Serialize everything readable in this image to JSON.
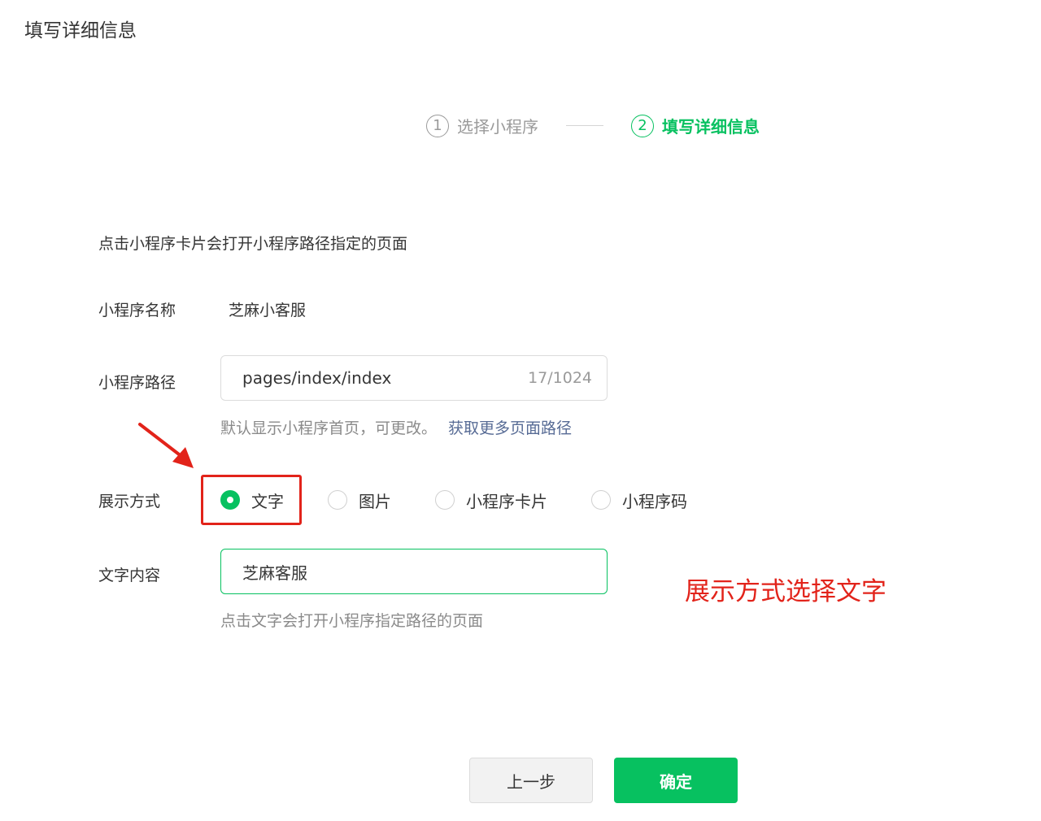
{
  "page": {
    "title": "填写详细信息"
  },
  "steps": [
    {
      "num": "1",
      "label": "选择小程序"
    },
    {
      "num": "2",
      "label": "填写详细信息"
    }
  ],
  "form": {
    "intro": "点击小程序卡片会打开小程序路径指定的页面",
    "name_label": "小程序名称",
    "name_value": "芝麻小客服",
    "path_label": "小程序路径",
    "path_value": "pages/index/index",
    "path_count": "17/1024",
    "path_hint": "默认显示小程序首页，可更改。",
    "path_link": "获取更多页面路径",
    "display_label": "展示方式",
    "display_options": [
      "文字",
      "图片",
      "小程序卡片",
      "小程序码"
    ],
    "selected_option": "文字",
    "text_label": "文字内容",
    "text_value": "芝麻客服",
    "text_hint": "点击文字会打开小程序指定路径的页面"
  },
  "annotation": {
    "text": "展示方式选择文字"
  },
  "buttons": {
    "prev": "上一步",
    "confirm": "确定"
  },
  "colors": {
    "brand_green": "#07c160",
    "annotation_red": "#e2231a",
    "link_blue": "#576b95"
  }
}
